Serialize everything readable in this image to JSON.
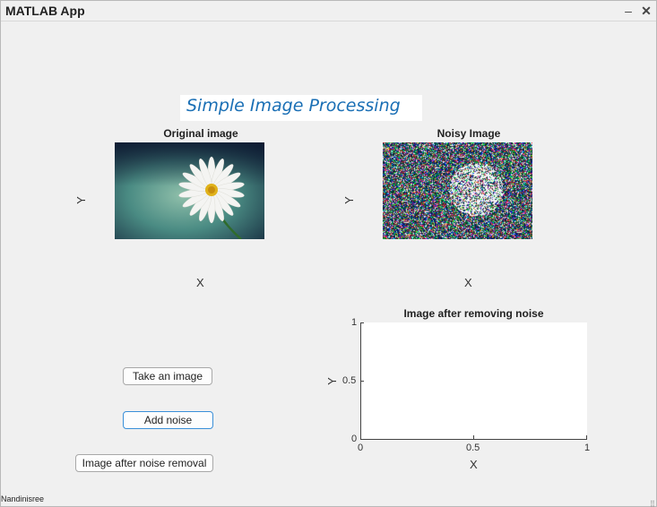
{
  "window": {
    "title": "MATLAB App",
    "minimize_glyph": "–",
    "close_glyph": "✕"
  },
  "heading": "Simple Image Processing",
  "axes": {
    "original": {
      "title": "Original image",
      "xlabel": "X",
      "ylabel": "Y",
      "image": "daisy-flower"
    },
    "noisy": {
      "title": "Noisy Image",
      "xlabel": "X",
      "ylabel": "Y",
      "image": "noisy-daisy"
    },
    "denoised": {
      "title": "Image after removing noise",
      "xlabel": "X",
      "ylabel": "Y",
      "xticks": [
        "0",
        "0.5",
        "1"
      ],
      "yticks": [
        "1",
        "0.5",
        "0"
      ]
    }
  },
  "buttons": {
    "take_image": "Take an image",
    "add_noise": "Add noise",
    "noise_removal": "Image after noise removal"
  },
  "footer": "Nandinisree",
  "resize_grip": "⣿"
}
